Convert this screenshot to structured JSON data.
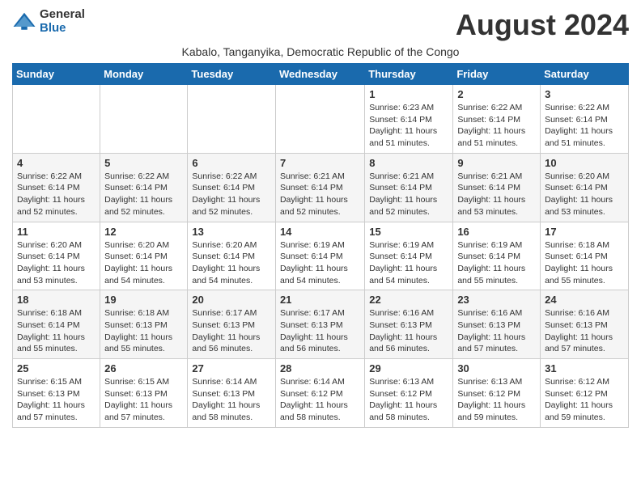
{
  "logo": {
    "general": "General",
    "blue": "Blue"
  },
  "title": "August 2024",
  "subtitle": "Kabalo, Tanganyika, Democratic Republic of the Congo",
  "days_of_week": [
    "Sunday",
    "Monday",
    "Tuesday",
    "Wednesday",
    "Thursday",
    "Friday",
    "Saturday"
  ],
  "weeks": [
    [
      {
        "day": "",
        "info": ""
      },
      {
        "day": "",
        "info": ""
      },
      {
        "day": "",
        "info": ""
      },
      {
        "day": "",
        "info": ""
      },
      {
        "day": "1",
        "info": "Sunrise: 6:23 AM\nSunset: 6:14 PM\nDaylight: 11 hours\nand 51 minutes."
      },
      {
        "day": "2",
        "info": "Sunrise: 6:22 AM\nSunset: 6:14 PM\nDaylight: 11 hours\nand 51 minutes."
      },
      {
        "day": "3",
        "info": "Sunrise: 6:22 AM\nSunset: 6:14 PM\nDaylight: 11 hours\nand 51 minutes."
      }
    ],
    [
      {
        "day": "4",
        "info": "Sunrise: 6:22 AM\nSunset: 6:14 PM\nDaylight: 11 hours\nand 52 minutes."
      },
      {
        "day": "5",
        "info": "Sunrise: 6:22 AM\nSunset: 6:14 PM\nDaylight: 11 hours\nand 52 minutes."
      },
      {
        "day": "6",
        "info": "Sunrise: 6:22 AM\nSunset: 6:14 PM\nDaylight: 11 hours\nand 52 minutes."
      },
      {
        "day": "7",
        "info": "Sunrise: 6:21 AM\nSunset: 6:14 PM\nDaylight: 11 hours\nand 52 minutes."
      },
      {
        "day": "8",
        "info": "Sunrise: 6:21 AM\nSunset: 6:14 PM\nDaylight: 11 hours\nand 52 minutes."
      },
      {
        "day": "9",
        "info": "Sunrise: 6:21 AM\nSunset: 6:14 PM\nDaylight: 11 hours\nand 53 minutes."
      },
      {
        "day": "10",
        "info": "Sunrise: 6:20 AM\nSunset: 6:14 PM\nDaylight: 11 hours\nand 53 minutes."
      }
    ],
    [
      {
        "day": "11",
        "info": "Sunrise: 6:20 AM\nSunset: 6:14 PM\nDaylight: 11 hours\nand 53 minutes."
      },
      {
        "day": "12",
        "info": "Sunrise: 6:20 AM\nSunset: 6:14 PM\nDaylight: 11 hours\nand 54 minutes."
      },
      {
        "day": "13",
        "info": "Sunrise: 6:20 AM\nSunset: 6:14 PM\nDaylight: 11 hours\nand 54 minutes."
      },
      {
        "day": "14",
        "info": "Sunrise: 6:19 AM\nSunset: 6:14 PM\nDaylight: 11 hours\nand 54 minutes."
      },
      {
        "day": "15",
        "info": "Sunrise: 6:19 AM\nSunset: 6:14 PM\nDaylight: 11 hours\nand 54 minutes."
      },
      {
        "day": "16",
        "info": "Sunrise: 6:19 AM\nSunset: 6:14 PM\nDaylight: 11 hours\nand 55 minutes."
      },
      {
        "day": "17",
        "info": "Sunrise: 6:18 AM\nSunset: 6:14 PM\nDaylight: 11 hours\nand 55 minutes."
      }
    ],
    [
      {
        "day": "18",
        "info": "Sunrise: 6:18 AM\nSunset: 6:14 PM\nDaylight: 11 hours\nand 55 minutes."
      },
      {
        "day": "19",
        "info": "Sunrise: 6:18 AM\nSunset: 6:13 PM\nDaylight: 11 hours\nand 55 minutes."
      },
      {
        "day": "20",
        "info": "Sunrise: 6:17 AM\nSunset: 6:13 PM\nDaylight: 11 hours\nand 56 minutes."
      },
      {
        "day": "21",
        "info": "Sunrise: 6:17 AM\nSunset: 6:13 PM\nDaylight: 11 hours\nand 56 minutes."
      },
      {
        "day": "22",
        "info": "Sunrise: 6:16 AM\nSunset: 6:13 PM\nDaylight: 11 hours\nand 56 minutes."
      },
      {
        "day": "23",
        "info": "Sunrise: 6:16 AM\nSunset: 6:13 PM\nDaylight: 11 hours\nand 57 minutes."
      },
      {
        "day": "24",
        "info": "Sunrise: 6:16 AM\nSunset: 6:13 PM\nDaylight: 11 hours\nand 57 minutes."
      }
    ],
    [
      {
        "day": "25",
        "info": "Sunrise: 6:15 AM\nSunset: 6:13 PM\nDaylight: 11 hours\nand 57 minutes."
      },
      {
        "day": "26",
        "info": "Sunrise: 6:15 AM\nSunset: 6:13 PM\nDaylight: 11 hours\nand 57 minutes."
      },
      {
        "day": "27",
        "info": "Sunrise: 6:14 AM\nSunset: 6:13 PM\nDaylight: 11 hours\nand 58 minutes."
      },
      {
        "day": "28",
        "info": "Sunrise: 6:14 AM\nSunset: 6:12 PM\nDaylight: 11 hours\nand 58 minutes."
      },
      {
        "day": "29",
        "info": "Sunrise: 6:13 AM\nSunset: 6:12 PM\nDaylight: 11 hours\nand 58 minutes."
      },
      {
        "day": "30",
        "info": "Sunrise: 6:13 AM\nSunset: 6:12 PM\nDaylight: 11 hours\nand 59 minutes."
      },
      {
        "day": "31",
        "info": "Sunrise: 6:12 AM\nSunset: 6:12 PM\nDaylight: 11 hours\nand 59 minutes."
      }
    ]
  ]
}
